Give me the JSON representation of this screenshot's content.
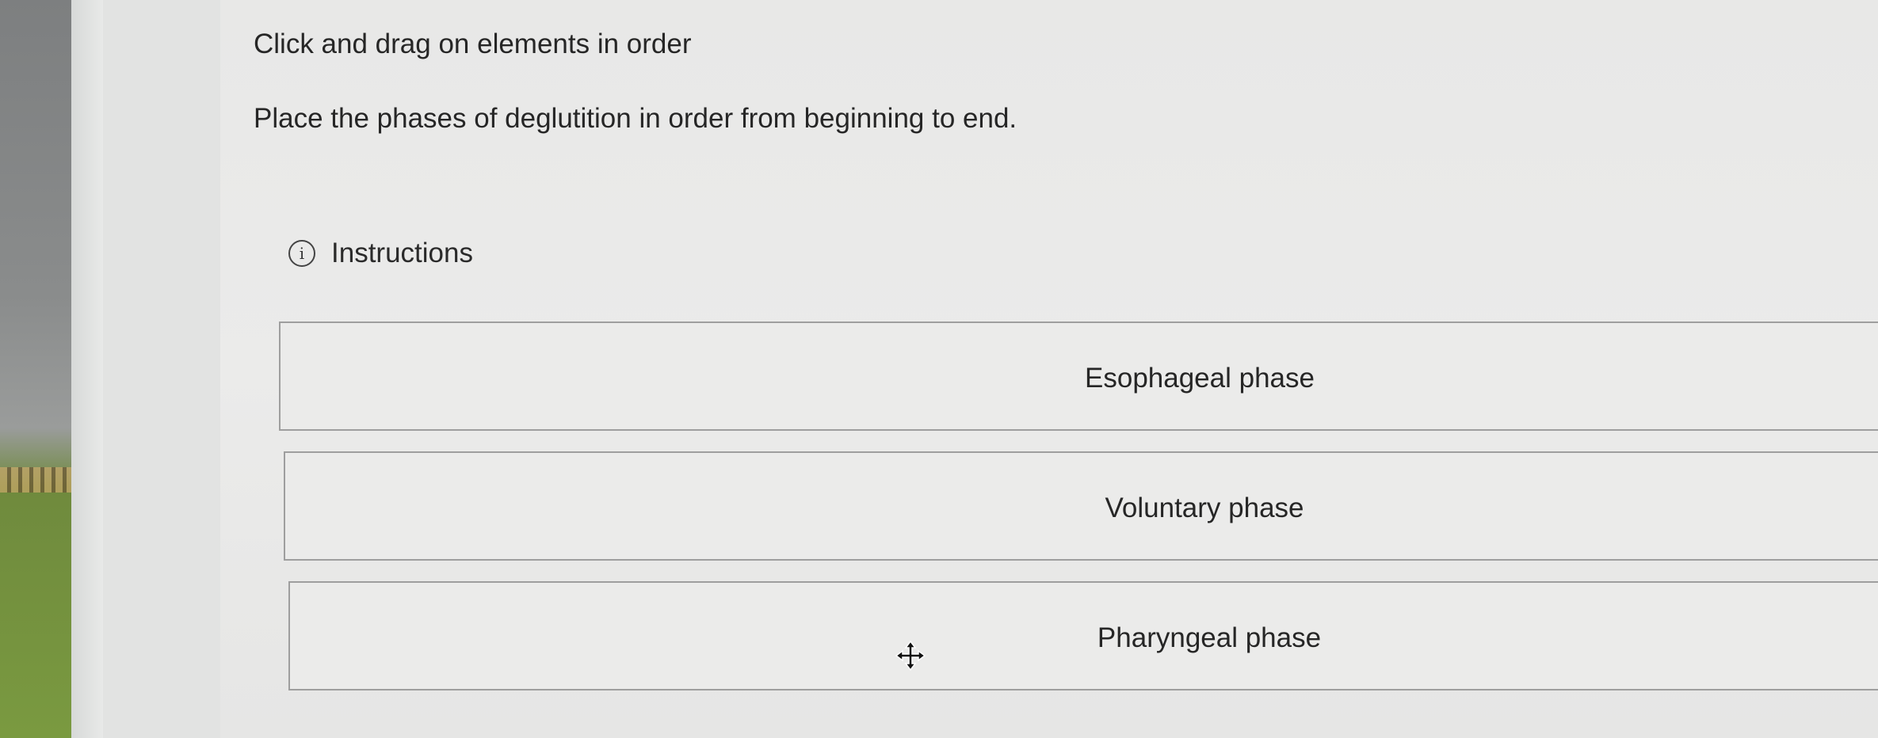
{
  "question": {
    "heading": "Click and drag on elements in order",
    "prompt": "Place the phases of deglutition in order from beginning to end.",
    "instructions_label": "Instructions",
    "info_icon_glyph": "i"
  },
  "items": [
    {
      "label": "Esophageal phase"
    },
    {
      "label": "Voluntary phase"
    },
    {
      "label": "Pharyngeal phase"
    }
  ],
  "icons": {
    "info": "info-circle-icon",
    "cursor": "move-cursor-icon"
  },
  "colors": {
    "text": "#262626",
    "border": "#9e9e9e",
    "background": "#ebebea"
  }
}
